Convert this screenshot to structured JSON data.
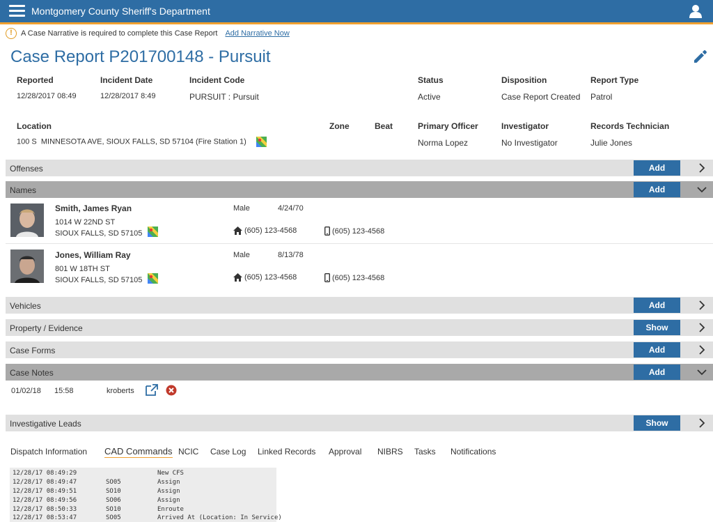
{
  "header": {
    "title": "Montgomery County Sheriff's Department"
  },
  "alert": {
    "message": "A Case Narrative is required to complete this Case Report",
    "link": "Add Narrative Now"
  },
  "page_title": "Case Report P201700148 - Pursuit",
  "details": {
    "reported": {
      "label": "Reported",
      "value": "12/28/2017 08:49"
    },
    "incident_date": {
      "label": "Incident Date",
      "value": "12/28/2017 8:49"
    },
    "incident_code": {
      "label": "Incident Code",
      "value": "PURSUIT : Pursuit"
    },
    "status": {
      "label": "Status",
      "value": "Active"
    },
    "disposition": {
      "label": "Disposition",
      "value": "Case Report Created"
    },
    "report_type": {
      "label": "Report Type",
      "value": "Patrol"
    },
    "location": {
      "label": "Location",
      "value": "100 S  MINNESOTA AVE, SIOUX FALLS, SD 57104 (Fire Station 1)"
    },
    "zone": {
      "label": "Zone",
      "value": ""
    },
    "beat": {
      "label": "Beat",
      "value": ""
    },
    "primary_officer": {
      "label": "Primary Officer",
      "value": "Norma Lopez"
    },
    "investigator": {
      "label": "Investigator",
      "value": "No Investigator"
    },
    "records_technician": {
      "label": "Records Technician",
      "value": "Julie Jones"
    }
  },
  "sections": {
    "offenses": {
      "title": "Offenses",
      "button": "Add"
    },
    "names": {
      "title": "Names",
      "button": "Add"
    },
    "vehicles": {
      "title": "Vehicles",
      "button": "Add"
    },
    "property": {
      "title": "Property / Evidence",
      "button": "Show"
    },
    "case_forms": {
      "title": "Case Forms",
      "button": "Add"
    },
    "case_notes": {
      "title": "Case Notes",
      "button": "Add"
    },
    "leads": {
      "title": "Investigative Leads",
      "button": "Show"
    }
  },
  "names": [
    {
      "name": "Smith, James Ryan",
      "address1": "1014 W 22ND ST",
      "address2": "SIOUX FALLS, SD 57105",
      "gender": "Male",
      "dob": "4/24/70",
      "home_phone": "(605) 123-4568",
      "mobile_phone": "(605) 123-4568"
    },
    {
      "name": "Jones, William Ray",
      "address1": "801 W 18TH ST",
      "address2": "SIOUX FALLS, SD 57105",
      "gender": "Male",
      "dob": "8/13/78",
      "home_phone": "(605) 123-4568",
      "mobile_phone": "(605) 123-4568"
    }
  ],
  "case_note": {
    "date": "01/02/18",
    "time": "15:58",
    "user": "kroberts"
  },
  "tabs": [
    "Dispatch Information",
    "CAD Commands",
    "NCIC",
    "Case Log",
    "Linked Records",
    "Approval",
    "NIBRS",
    "Tasks",
    "Notifications"
  ],
  "active_tab": "CAD Commands",
  "cad_log": [
    {
      "time": "12/28/17 08:49:29",
      "unit": "",
      "action": "New CFS"
    },
    {
      "time": "12/28/17 08:49:47",
      "unit": "SO05",
      "action": "Assign"
    },
    {
      "time": "12/28/17 08:49:51",
      "unit": "SO10",
      "action": "Assign"
    },
    {
      "time": "12/28/17 08:49:56",
      "unit": "SO06",
      "action": "Assign"
    },
    {
      "time": "12/28/17 08:50:33",
      "unit": "SO10",
      "action": "Enroute"
    },
    {
      "time": "12/28/17 08:53:47",
      "unit": "SO05",
      "action": "Arrived At (Location: In Service)"
    }
  ],
  "colors": {
    "primary": "#2e6da4",
    "accent": "#f0a030",
    "section_bg": "#e0e0e0",
    "section_open_bg": "#a9a9a9"
  }
}
